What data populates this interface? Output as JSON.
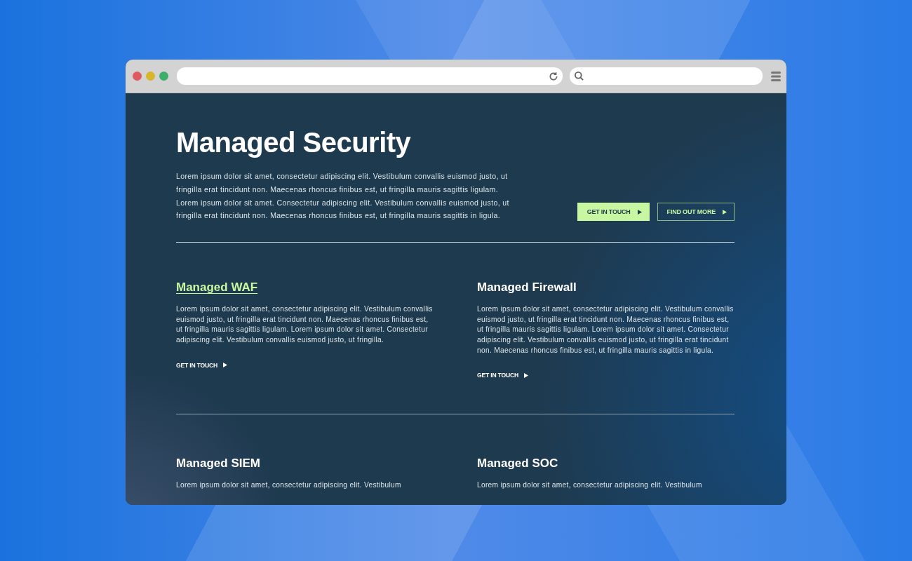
{
  "hero": {
    "title": "Managed Security",
    "body": "Lorem ipsum dolor sit amet, consectetur adipiscing elit. Vestibulum convallis euismod justo, ut fringilla erat tincidunt non. Maecenas rhoncus finibus est, ut fringilla mauris sagittis ligulam. Lorem ipsum dolor sit amet. Consectetur adipiscing elit. Vestibulum convallis euismod justo, ut fringilla erat tincidunt non. Maecenas rhoncus finibus est, ut fringilla mauris sagittis in ligula.",
    "buttons": [
      {
        "label": "GET IN TOUCH",
        "kind": "filled"
      },
      {
        "label": "FIND OUT MORE",
        "kind": "outline"
      }
    ]
  },
  "services": [
    {
      "title": "Managed WAF",
      "highlighted": true,
      "body": "Lorem ipsum dolor sit amet, consectetur adipiscing elit. Vestibulum convallis euismod justo, ut fringilla erat tincidunt non. Maecenas rhoncus finibus est, ut fringilla mauris sagittis ligulam. Lorem ipsum dolor sit amet. Consectetur adipiscing elit. Vestibulum convallis euismod justo, ut fringilla.",
      "link": "GET IN TOUCH"
    },
    {
      "title": "Managed Firewall",
      "highlighted": false,
      "body": "Lorem ipsum dolor sit amet, consectetur adipiscing elit. Vestibulum convallis euismod justo, ut fringilla erat tincidunt non. Maecenas rhoncus finibus est, ut fringilla mauris sagittis ligulam. Lorem ipsum dolor sit amet. Consectetur adipiscing elit. Vestibulum convallis euismod justo, ut fringilla erat tincidunt non. Maecenas rhoncus finibus est, ut fringilla mauris sagittis in ligula.",
      "link": "GET IN TOUCH"
    },
    {
      "title": "Managed SIEM",
      "highlighted": false,
      "body": "Lorem ipsum dolor sit amet, consectetur adipiscing elit. Vestibulum"
    },
    {
      "title": "Managed SOC",
      "highlighted": false,
      "body": "Lorem ipsum dolor sit amet, consectetur adipiscing elit. Vestibulum"
    }
  ]
}
